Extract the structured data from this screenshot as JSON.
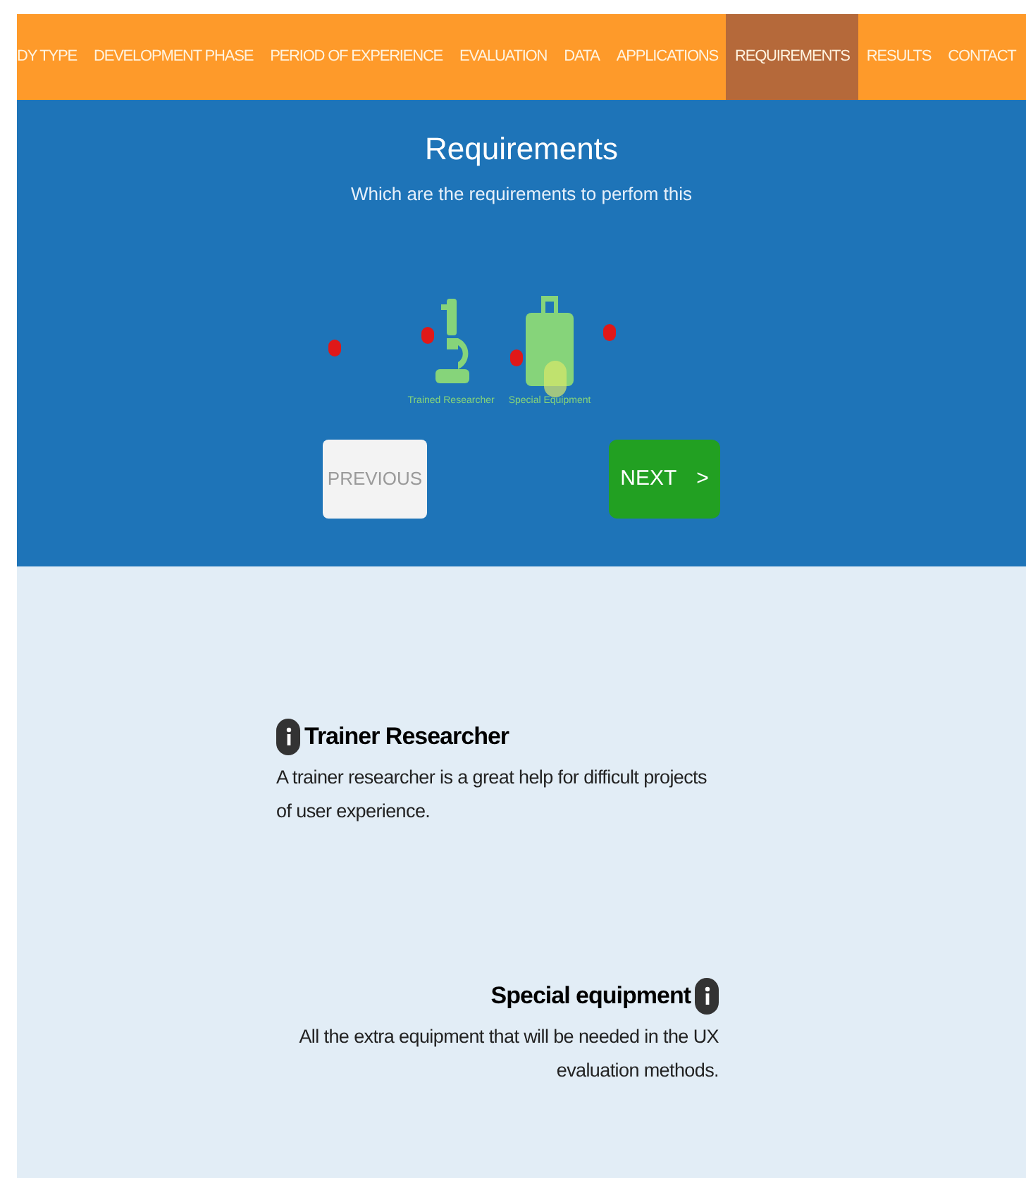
{
  "nav": {
    "items": [
      {
        "label": "DY TYPE",
        "selected": false
      },
      {
        "label": "DEVELOPMENT PHASE",
        "selected": false
      },
      {
        "label": "PERIOD OF EXPERIENCE",
        "selected": false
      },
      {
        "label": "EVALUATION",
        "selected": false
      },
      {
        "label": "DATA",
        "selected": false
      },
      {
        "label": "APPLICATIONS",
        "selected": false
      },
      {
        "label": "REQUIREMENTS",
        "selected": true
      },
      {
        "label": "RESULTS",
        "selected": false
      },
      {
        "label": "CONTACT",
        "selected": false
      }
    ]
  },
  "hero": {
    "title": "Requirements",
    "subtitle": "Which are the requirements to perfom this",
    "options": [
      {
        "kind": "microscope",
        "label": "Trained Researcher"
      },
      {
        "kind": "suitcase",
        "label": "Special Equipment"
      }
    ],
    "previous": "PREVIOUS",
    "next": "NEXT",
    "next_arrow": ">"
  },
  "details": [
    {
      "title": "Trainer Researcher",
      "text": "A trainer researcher is a great help for difficult projects of user experience."
    },
    {
      "title": "Special equipment",
      "text": "All the extra equipment that will be needed in the UX evaluation methods."
    }
  ]
}
